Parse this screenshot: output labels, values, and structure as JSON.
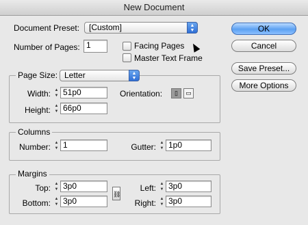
{
  "window": {
    "title": "New Document"
  },
  "preset": {
    "label": "Document Preset:",
    "value": "[Custom]"
  },
  "pages": {
    "label": "Number of Pages:",
    "value": "1",
    "facing_pages": {
      "label": "Facing Pages",
      "checked": false
    },
    "master_text_frame": {
      "label": "Master Text Frame",
      "checked": false
    }
  },
  "buttons": {
    "ok": "OK",
    "cancel": "Cancel",
    "save_preset": "Save Preset...",
    "more_options": "More Options"
  },
  "page_size": {
    "label": "Page Size:",
    "value": "Letter",
    "width_label": "Width:",
    "width_value": "51p0",
    "height_label": "Height:",
    "height_value": "66p0",
    "orientation_label": "Orientation:",
    "orientation_selected": "portrait"
  },
  "columns": {
    "title": "Columns",
    "number_label": "Number:",
    "number_value": "1",
    "gutter_label": "Gutter:",
    "gutter_value": "1p0"
  },
  "margins": {
    "title": "Margins",
    "top_label": "Top:",
    "top_value": "3p0",
    "bottom_label": "Bottom:",
    "bottom_value": "3p0",
    "left_label": "Left:",
    "left_value": "3p0",
    "right_label": "Right:",
    "right_value": "3p0"
  },
  "colors": {
    "default_button": "#5da1f2",
    "popup_arrows": "#2f6fd6"
  }
}
